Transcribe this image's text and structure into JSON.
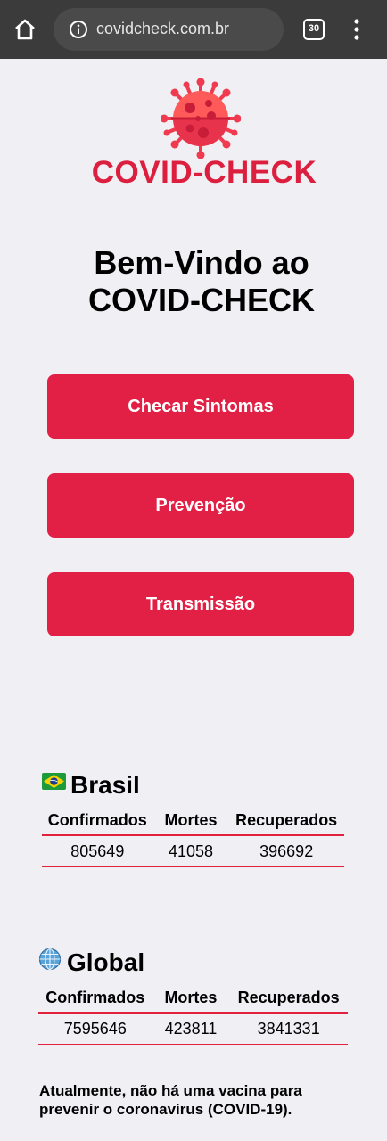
{
  "browser": {
    "url": "covidcheck.com.br",
    "tab_count": "30"
  },
  "logo": {
    "text": "COVID-CHECK"
  },
  "welcome": {
    "line1": "Bem-Vindo ao",
    "line2": "COVID-CHECK"
  },
  "buttons": [
    {
      "label": "Checar Sintomas"
    },
    {
      "label": "Prevenção"
    },
    {
      "label": "Transmissão"
    }
  ],
  "brasil": {
    "title": "Brasil",
    "headers": [
      "Confirmados",
      "Mortes",
      "Recuperados"
    ],
    "values": [
      "805649",
      "41058",
      "396692"
    ]
  },
  "global": {
    "title": "Global",
    "headers": [
      "Confirmados",
      "Mortes",
      "Recuperados"
    ],
    "values": [
      "7595646",
      "423811",
      "3841331"
    ]
  },
  "note": "Atualmente, não há uma vacina para prevenir o coronavírus (COVID-19).",
  "colors": {
    "accent": "#e21f44",
    "browser_bar": "#3b3b3b",
    "background": "#f0eff4"
  },
  "icons": {
    "home": "home-icon",
    "info": "info-icon",
    "menu": "more-vert-icon",
    "logo": "virus-icon",
    "brasil_flag": "brazil-flag-icon",
    "global": "globe-icon"
  }
}
